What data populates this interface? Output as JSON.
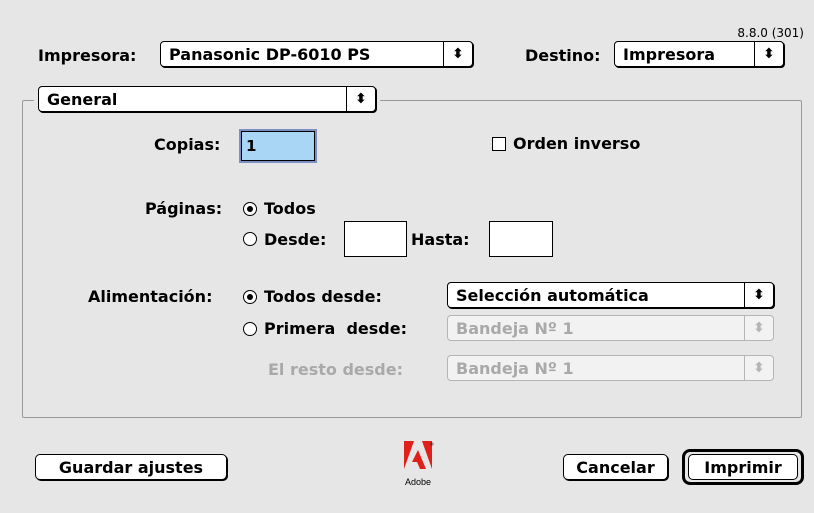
{
  "dialog": {
    "version": "8.8.0 (301)",
    "printer_label": "Impresora:",
    "printer_value": "Panasonic DP-6010 PS",
    "destination_label": "Destino:",
    "destination_value": "Impresora",
    "panel_value": "General"
  },
  "general": {
    "copies_label": "Copias:",
    "copies_value": "1",
    "reverse_order_label": "Orden inverso",
    "pages_label": "Páginas:",
    "all_label": "Todos",
    "from_label": "Desde:",
    "to_label": "Hasta:",
    "feed_label": "Alimentación:",
    "all_from_label": "Todos desde:",
    "all_from_value": "Selección automática",
    "first_from_label": "Primera  desde:",
    "first_from_value": "Bandeja Nº 1",
    "rest_from_label": "El resto desde:",
    "rest_from_value": "Bandeja Nº 1"
  },
  "footer": {
    "save_label": "Guardar ajustes",
    "logo_text": "Adobe",
    "cancel_label": "Cancelar",
    "print_label": "Imprimir"
  },
  "icons": {
    "arrows": "up-down-arrows-icon"
  }
}
